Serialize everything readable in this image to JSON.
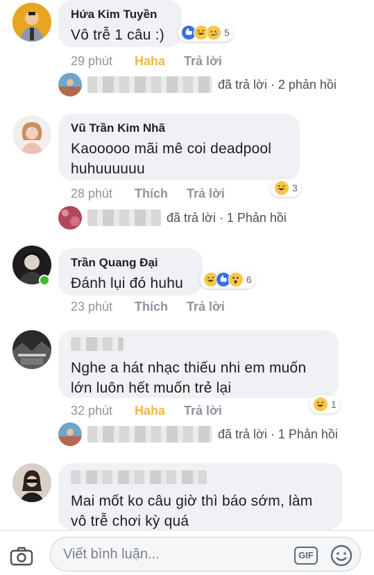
{
  "comments": [
    {
      "author": "Hứa Kim Tuyền",
      "text": "Vô trễ 1 câu :)",
      "time": "29 phút",
      "reaction_label": "Haha",
      "reply_label": "Trả lời",
      "reaction_count": "5",
      "reply_summary": "đã trả lời · 2 phản hồi"
    },
    {
      "author": "Vũ Trần Kim Nhã",
      "text_lines": [
        "Kaooooo mãi mê coi deadpool",
        "huhuuuuuu"
      ],
      "time": "28 phút",
      "reaction_label": "Thích",
      "reply_label": "Trả lời",
      "reaction_count": "3",
      "reply_summary": "đã trả lời · 1 Phản hồi"
    },
    {
      "author": "Trần Quang Đại",
      "text": "Đánh lụi đó huhu",
      "time": "23 phút",
      "reaction_label": "Thích",
      "reply_label": "Trả lời",
      "reaction_count": "6"
    },
    {
      "text_lines": [
        "Nghe a hát nhạc thiếu nhi em muốn",
        "lớn luôn hết muốn trẻ lại"
      ],
      "time": "32 phút",
      "reaction_label": "Haha",
      "reply_label": "Trả lời",
      "reaction_count": "1",
      "reply_summary": "đã trả lời · 1 Phản hồi"
    },
    {
      "text_lines": [
        "Mai mốt ko câu giờ thì báo sớm, làm",
        "vô trễ chơi kỳ quá"
      ]
    }
  ],
  "composer": {
    "placeholder": "Viết bình luận...",
    "gif_label": "GIF"
  },
  "colors": {
    "haha": "#f0b93a",
    "meta": "#8d949e",
    "bubble": "#f0f1f4",
    "like_blue": "#3b6fe0",
    "online_green": "#42b72a"
  }
}
